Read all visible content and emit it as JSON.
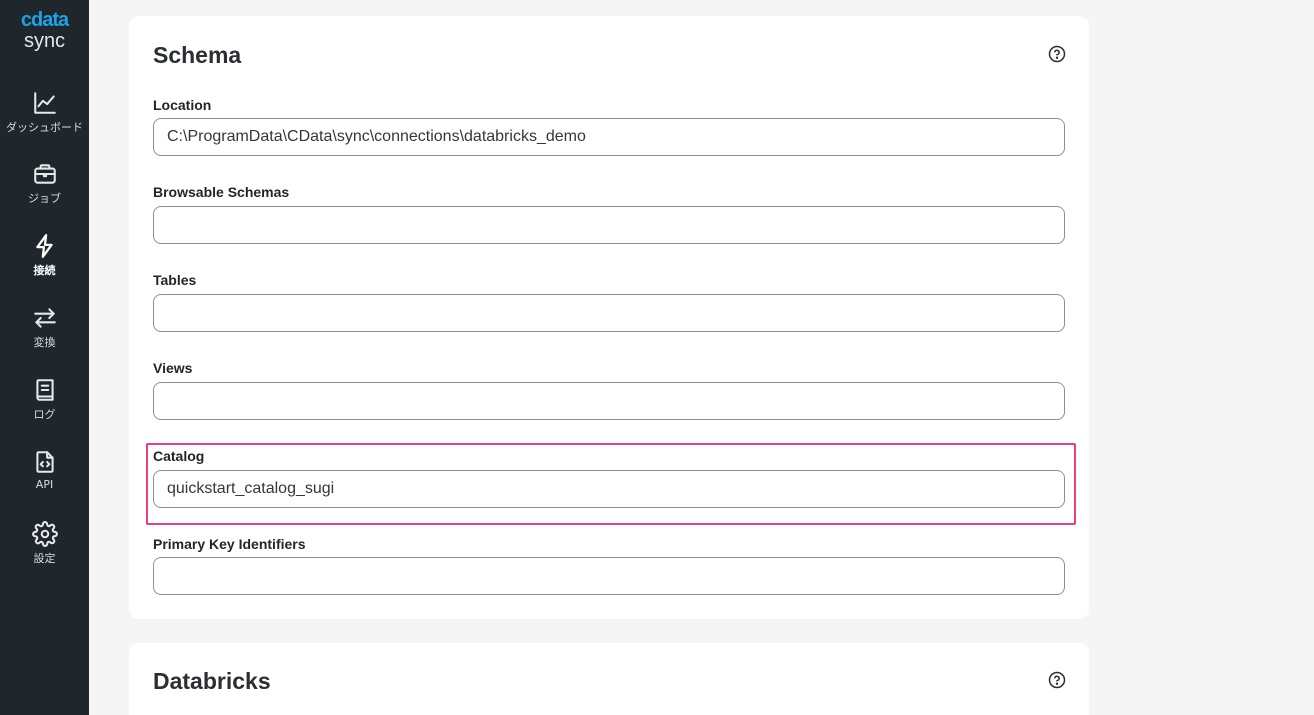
{
  "app": {
    "logo_top": "cdata",
    "logo_bottom": "sync"
  },
  "sidebar": {
    "items": [
      {
        "label": "ダッシュボード",
        "icon": "chart-line-icon"
      },
      {
        "label": "ジョブ",
        "icon": "briefcase-icon"
      },
      {
        "label": "接続",
        "icon": "bolt-icon"
      },
      {
        "label": "変換",
        "icon": "arrows-exchange-icon"
      },
      {
        "label": "ログ",
        "icon": "book-icon"
      },
      {
        "label": "API",
        "icon": "file-code-icon"
      },
      {
        "label": "設定",
        "icon": "gear-icon"
      }
    ],
    "active": "接続"
  },
  "schema": {
    "title": "Schema",
    "fields": {
      "location": {
        "label": "Location",
        "value": "C:\\ProgramData\\CData\\sync\\connections\\databricks_demo"
      },
      "browsable_schemas": {
        "label": "Browsable Schemas",
        "value": ""
      },
      "tables": {
        "label": "Tables",
        "value": ""
      },
      "views": {
        "label": "Views",
        "value": ""
      },
      "catalog": {
        "label": "Catalog",
        "value": "quickstart_catalog_sugi"
      },
      "primary_key_identifiers": {
        "label": "Primary Key Identifiers",
        "value": ""
      }
    }
  },
  "databricks": {
    "title": "Databricks"
  },
  "colors": {
    "sidebar_bg": "#1f262c",
    "brand": "#1aa3e8",
    "highlight": "#e8417e",
    "page_bg": "#f5f5f5"
  }
}
